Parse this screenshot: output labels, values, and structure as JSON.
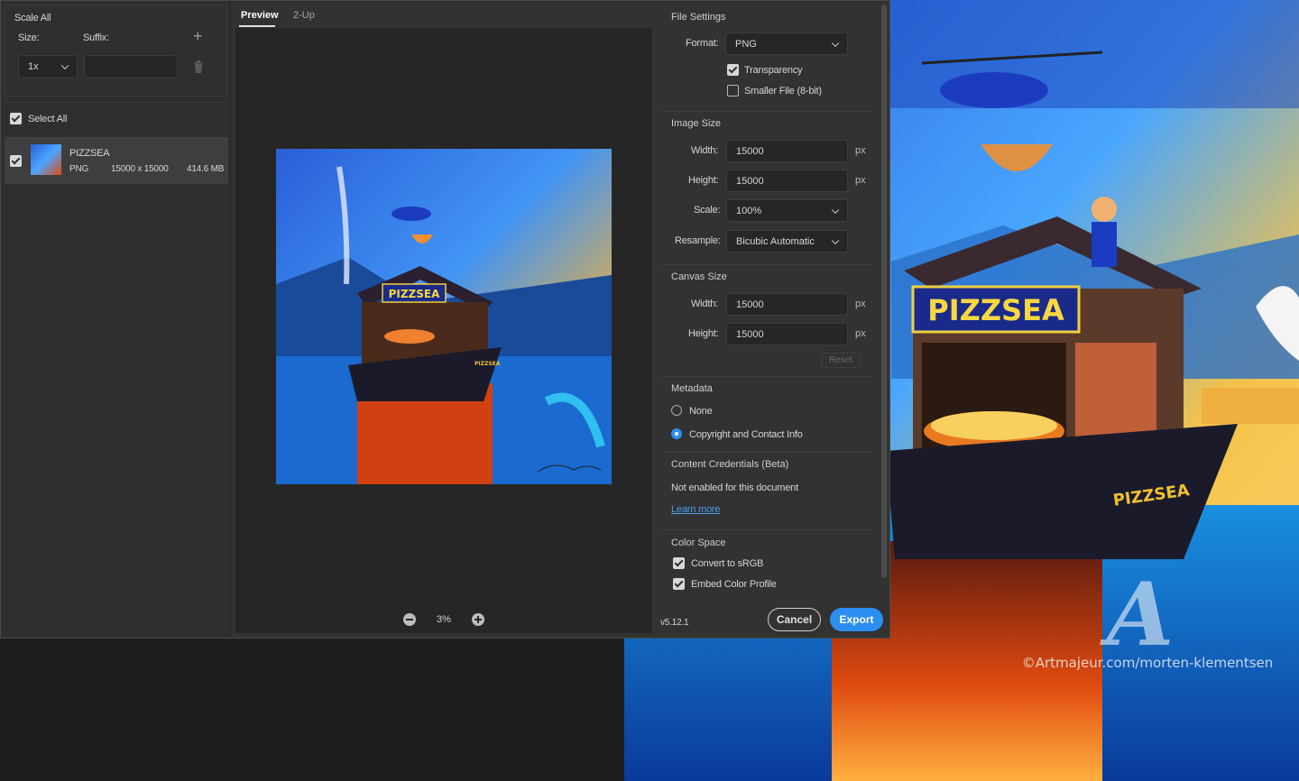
{
  "left": {
    "scale_all": "Scale All",
    "size_label": "Size:",
    "suffix_label": "Suffix:",
    "scale_value": "1x",
    "suffix_value": "",
    "select_all": "Select All",
    "asset": {
      "name": "PIZZSEA",
      "format": "PNG",
      "dims": "15000 x 15000",
      "size": "414.6 MB"
    }
  },
  "preview": {
    "tabs": [
      "Preview",
      "2-Up"
    ],
    "zoom": "3%",
    "art_sign_text": "PIZZSEA",
    "art_hull_text": "PIZZSEA"
  },
  "file_settings": {
    "title": "File Settings",
    "format_label": "Format:",
    "format_value": "PNG",
    "transparency": "Transparency",
    "smaller_file": "Smaller File (8-bit)"
  },
  "image_size": {
    "title": "Image Size",
    "width_label": "Width:",
    "width_value": "15000",
    "height_label": "Height:",
    "height_value": "15000",
    "scale_label": "Scale:",
    "scale_value": "100%",
    "resample_label": "Resample:",
    "resample_value": "Bicubic Automatic",
    "unit": "px"
  },
  "canvas_size": {
    "title": "Canvas Size",
    "width_label": "Width:",
    "width_value": "15000",
    "height_label": "Height:",
    "height_value": "15000",
    "unit": "px",
    "reset": "Reset"
  },
  "metadata": {
    "title": "Metadata",
    "none": "None",
    "copyright": "Copyright and Contact Info"
  },
  "credentials": {
    "title": "Content Credentials (Beta)",
    "status": "Not enabled for this document",
    "learn_more": "Learn more"
  },
  "color_space": {
    "title": "Color Space",
    "convert": "Convert to sRGB",
    "embed": "Embed Color Profile"
  },
  "footer": {
    "version": "v5.12.1",
    "cancel": "Cancel",
    "export": "Export"
  },
  "background": {
    "sign_text": "PIZZSEA",
    "hull_text": "PIZZSEA",
    "watermark_logo": "A",
    "watermark_text": "©Artmajeur.com/morten-klementsen"
  },
  "colors": {
    "accent": "#2c8ef0",
    "dialog_bg": "#323232",
    "preview_bg": "#262626"
  }
}
